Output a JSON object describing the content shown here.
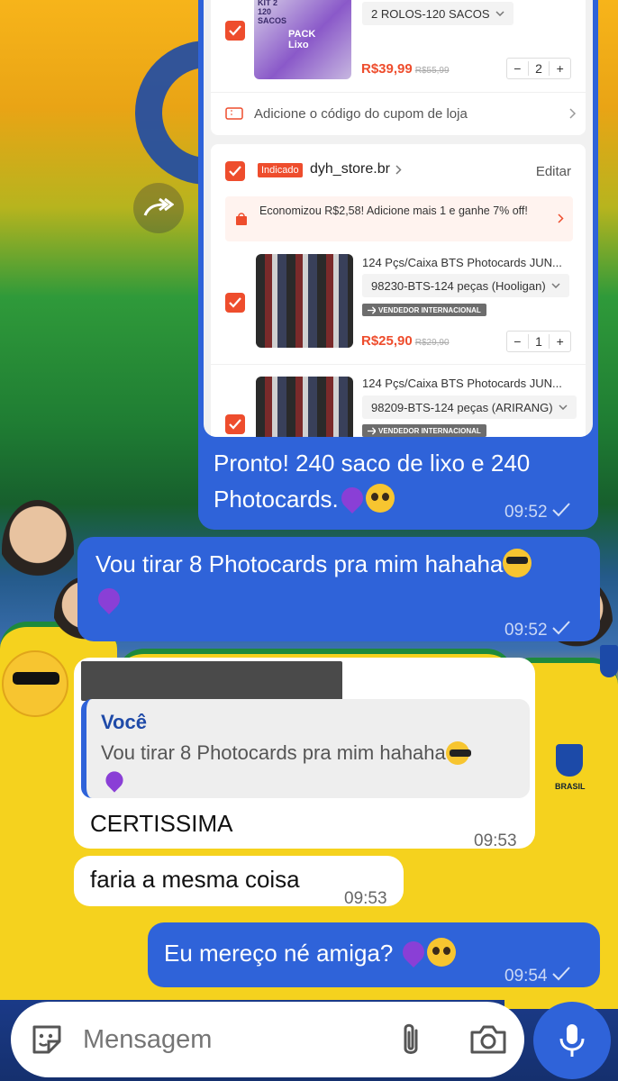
{
  "shop": {
    "item1": {
      "thumb_text_top": "KIT 2 120 SACOS",
      "thumb_text_pack": "PACK Lixo",
      "variant": "2 ROLOS-120 SACOS",
      "price": "R$39,99",
      "old_price": "R$55,99",
      "qty": "2"
    },
    "coupon_text": "Adicione o código do cupom de loja",
    "store": {
      "badge": "Indicado",
      "name": "dyh_store.br",
      "edit_label": "Editar",
      "promo_text": "Economizou R$2,58! Adicione mais 1 e ganhe 7% off!"
    },
    "item2": {
      "title": "124 Pçs/Caixa BTS Photocards JUN...",
      "variant": "98230-BTS-124 peças (Hooligan)",
      "badge": "VENDEDOR INTERNACIONAL",
      "price": "R$25,90",
      "old_price": "R$29,90",
      "qty": "1"
    },
    "item3": {
      "title": "124 Pçs/Caixa BTS Photocards JUN...",
      "variant": "98209-BTS-124 peças (ARIRANG)",
      "badge": "VENDEDOR INTERNACIONAL"
    }
  },
  "messages": {
    "m1": {
      "text": "Pronto! 240 saco de lixo e 240 Photocards.",
      "time": "09:52"
    },
    "m2": {
      "text": "Vou tirar 8 Photocards pra mim hahaha",
      "time": "09:52"
    },
    "m3": {
      "quote_author": "Você",
      "quote_text": "Vou tirar 8 Photocards pra mim hahaha",
      "text": "CERTISSIMA",
      "time": "09:53"
    },
    "m4": {
      "text": "faria a mesma coisa",
      "time": "09:53"
    },
    "m5": {
      "text": "Eu mereço né amiga?",
      "time": "09:54"
    }
  },
  "composer": {
    "placeholder": "Mensagem"
  },
  "background": {
    "crest_label": "BRASIL"
  },
  "colors": {
    "bubble_out": "#2f63d9",
    "shop_accent": "#ee4d2d"
  },
  "icons": [
    "forward-icon",
    "sticker-icon",
    "attach-icon",
    "camera-icon",
    "mic-icon",
    "check-icon",
    "chevron-right-icon",
    "chevron-down-icon",
    "coupon-icon",
    "bag-icon",
    "plane-icon"
  ]
}
